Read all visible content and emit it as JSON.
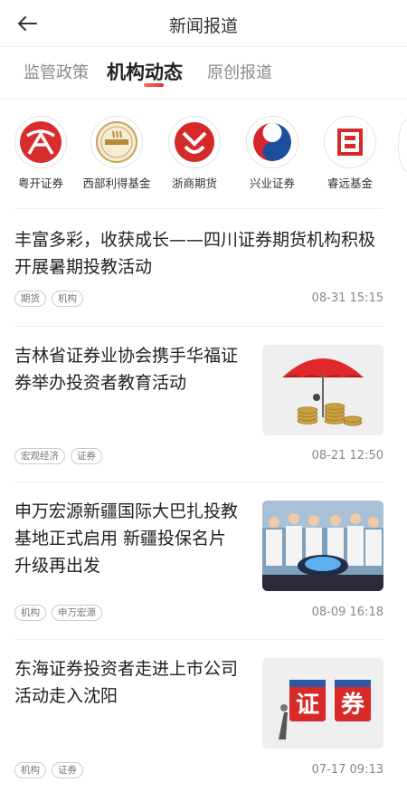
{
  "header": {
    "title": "新闻报道",
    "back_icon": "back-arrow-icon"
  },
  "tabs": [
    {
      "label": "监管政策",
      "active": false
    },
    {
      "label": "机构动态",
      "active": true
    },
    {
      "label": "原创报道",
      "active": false
    }
  ],
  "orgs": [
    {
      "name": "粤开证券",
      "logo": "yuekai-logo"
    },
    {
      "name": "西部利得基金",
      "logo": "xibu-lide-logo"
    },
    {
      "name": "浙商期货",
      "logo": "zheshang-logo"
    },
    {
      "name": "兴业证券",
      "logo": "xingye-logo"
    },
    {
      "name": "睿远基金",
      "logo": "ruiyuan-logo"
    }
  ],
  "articles": [
    {
      "title_line1": "丰富多彩，收获成长——四川证券期货机构积极",
      "title_line2": "开展暑期投教活动",
      "title_line3": "",
      "tags": [
        "期货",
        "机构"
      ],
      "time": "08-31 15:15",
      "thumb": ""
    },
    {
      "title_line1": "吉林省证券业协会携手华福证",
      "title_line2": "券举办投资者教育活动",
      "title_line3": "",
      "tags": [
        "宏观经济",
        "证券"
      ],
      "time": "08-21 12:50",
      "thumb": "red-umbrella-coins-image"
    },
    {
      "title_line1": "申万宏源新疆国际大巴扎投教",
      "title_line2": "基地正式启用 新疆投保名片",
      "title_line3": "升级再出发",
      "tags": [
        "机构",
        "申万宏源"
      ],
      "time": "08-09 16:18",
      "thumb": "launch-ceremony-photo"
    },
    {
      "title_line1": "东海证券投资者走进上市公司",
      "title_line2": "活动走入沈阳",
      "title_line3": "",
      "tags": [
        "机构",
        "证券"
      ],
      "time": "07-17 09:13",
      "thumb": "securities-blocks-image"
    }
  ],
  "thumb_text": {
    "block1": "证",
    "block2": "券"
  },
  "colors": {
    "accent": "#e23131",
    "text": "#222222",
    "muted": "#888888"
  }
}
